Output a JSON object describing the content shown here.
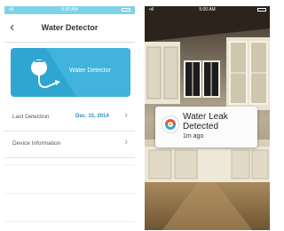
{
  "phone_detector": {
    "status_bar": {
      "signal": "•ıll",
      "time": "5:00 AM"
    },
    "nav": {
      "back_glyph": "‹",
      "title": "Water Detector"
    },
    "hero": {
      "label": "Water Detector"
    },
    "rows": [
      {
        "label": "Last Detection",
        "value": "Dec. 15, 2014",
        "chevron": "›"
      },
      {
        "label": "Device Information",
        "value": "",
        "chevron": "›"
      }
    ],
    "colors": {
      "accent": "#2fa6d2",
      "status_bar": "#7fd3e6",
      "value_text": "#2d8fc4"
    }
  },
  "phone_notification": {
    "status_bar": {
      "signal": "•ıll",
      "time": "5:00 AM"
    },
    "notification": {
      "title_line1": "Water Leak",
      "title_line2": "Detected",
      "time_ago": "1m ago",
      "icon": "app-logo-icon"
    }
  }
}
